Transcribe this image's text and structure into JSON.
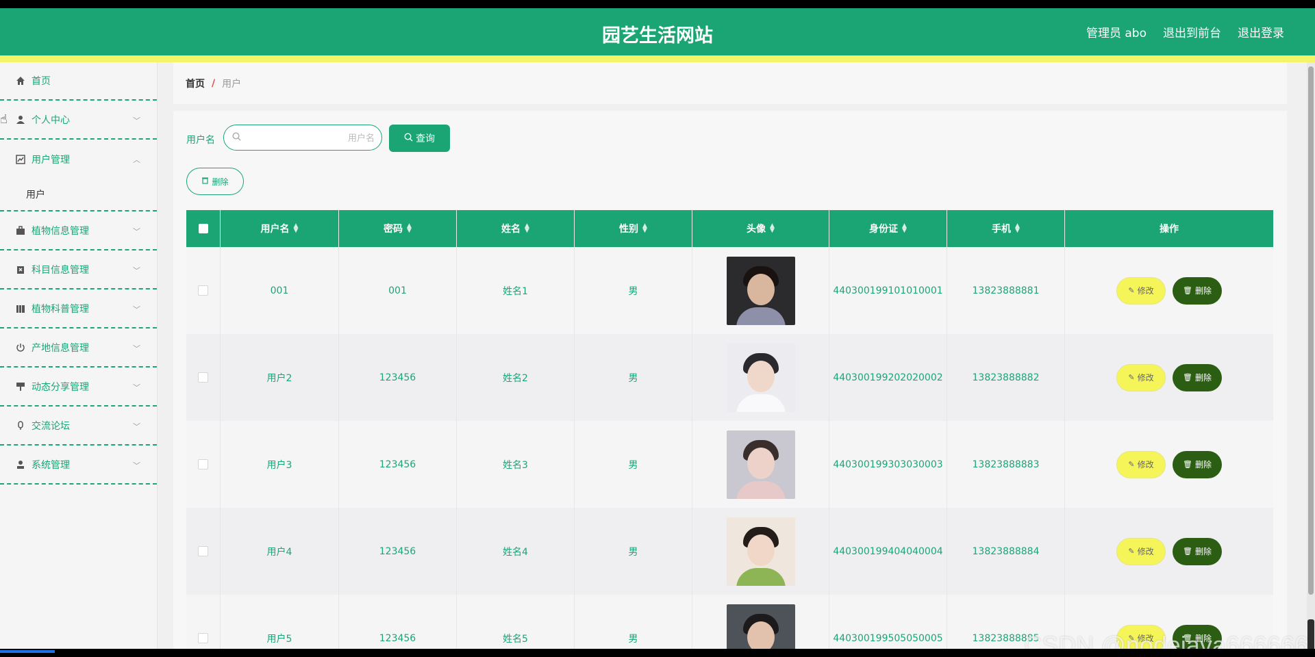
{
  "header": {
    "title": "园艺生活网站",
    "admin_label": "管理员 abo",
    "to_front": "退出到前台",
    "logout": "退出登录"
  },
  "sidebar": {
    "items": [
      {
        "label": "首页",
        "icon": "home-icon"
      },
      {
        "label": "个人中心",
        "icon": "user-icon"
      },
      {
        "label": "用户管理",
        "icon": "chart-icon",
        "expanded": true,
        "children": [
          "用户"
        ]
      },
      {
        "label": "植物信息管理",
        "icon": "briefcase-icon"
      },
      {
        "label": "科目信息管理",
        "icon": "clipboard-icon"
      },
      {
        "label": "植物科普管理",
        "icon": "library-icon"
      },
      {
        "label": "产地信息管理",
        "icon": "power-icon"
      },
      {
        "label": "动态分享管理",
        "icon": "brush-icon"
      },
      {
        "label": "交流论坛",
        "icon": "mic-icon"
      },
      {
        "label": "系统管理",
        "icon": "admin-icon"
      }
    ]
  },
  "breadcrumb": {
    "home": "首页",
    "separator": "/",
    "current": "用户"
  },
  "search": {
    "label": "用户名",
    "placeholder": "用户名",
    "value": "",
    "button": "查询"
  },
  "toolbar": {
    "delete_label": "删除"
  },
  "table": {
    "columns": [
      "用户名",
      "密码",
      "姓名",
      "性别",
      "头像",
      "身份证",
      "手机",
      "操作"
    ],
    "rows": [
      {
        "username": "001",
        "password": "001",
        "name": "姓名1",
        "gender": "男",
        "id_card": "440300199101010001",
        "phone": "13823888881"
      },
      {
        "username": "用户2",
        "password": "123456",
        "name": "姓名2",
        "gender": "男",
        "id_card": "440300199202020002",
        "phone": "13823888882"
      },
      {
        "username": "用户3",
        "password": "123456",
        "name": "姓名3",
        "gender": "男",
        "id_card": "440300199303030003",
        "phone": "13823888883"
      },
      {
        "username": "用户4",
        "password": "123456",
        "name": "姓名4",
        "gender": "男",
        "id_card": "440300199404040004",
        "phone": "13823888884"
      },
      {
        "username": "用户5",
        "password": "123456",
        "name": "姓名5",
        "gender": "男",
        "id_card": "440300199505050005",
        "phone": "13823888885"
      }
    ],
    "edit_label": "修改",
    "delete_label": "删除"
  },
  "watermark": "CSDN @nodejava666666",
  "colors": {
    "primary": "#1ca574",
    "accent_yellow": "#f4f467",
    "delete_dark": "#2b5e13",
    "edit_yellow": "#f5f55a"
  }
}
